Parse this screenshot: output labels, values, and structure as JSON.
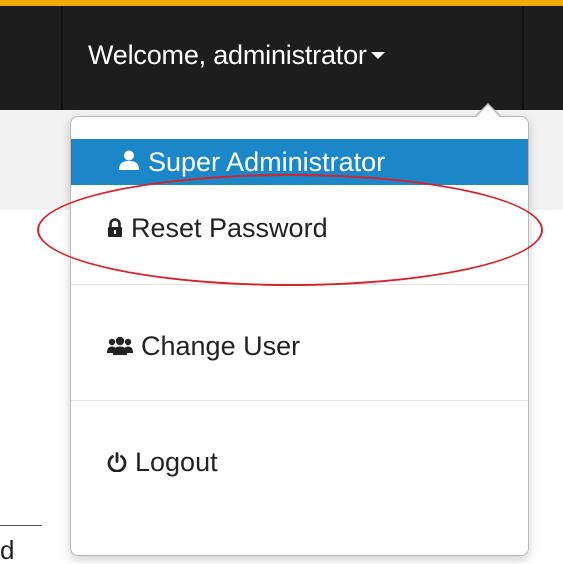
{
  "navbar": {
    "welcome_label": "Welcome, administrator",
    "accent_color": "#f0ab00",
    "background_color": "#1d1d1d"
  },
  "user_menu": {
    "header": {
      "label": "Super Administrator",
      "icon": "user-icon",
      "color": "#1b87c8"
    },
    "items": [
      {
        "label": "Reset Password",
        "icon": "lock-icon"
      },
      {
        "label": "Change User",
        "icon": "users-icon"
      },
      {
        "label": "Logout",
        "icon": "power-icon"
      }
    ],
    "annotation_color": "#d4232a"
  },
  "background": {
    "fragment_text": "d"
  }
}
